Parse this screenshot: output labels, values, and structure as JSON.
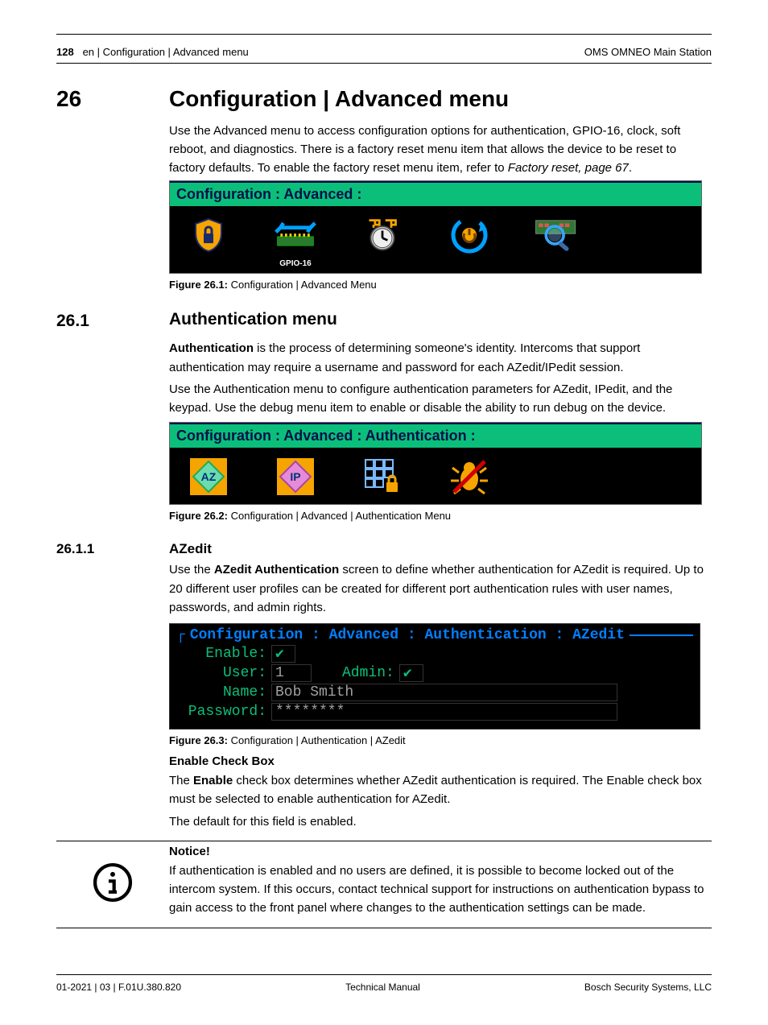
{
  "header": {
    "page_no": "128",
    "left": "en | Configuration | Advanced menu",
    "right": "OMS OMNEO Main Station"
  },
  "section26": {
    "num": "26",
    "title": "Configuration | Advanced menu",
    "p1": "Use the Advanced menu to access configuration options for authentication, GPIO-16, clock, soft reboot, and diagnostics. There is a factory reset menu item that allows the device to be reset to factory defaults. To enable the factory reset menu item, refer to ",
    "p1_link": "Factory reset, page 67",
    "p1_tail": "."
  },
  "fig261": {
    "breadcrumb": "Configuration : Advanced :",
    "caption_label": "Figure 26.1:",
    "caption": "Configuration | Advanced Menu",
    "icons": [
      "",
      "GPIO-16",
      "",
      "",
      ""
    ]
  },
  "section261": {
    "num": "26.1",
    "title": "Authentication menu",
    "p1a": "Authentication",
    "p1b": " is the process of determining someone's identity. Intercoms that support authentication may require a username and password for each AZedit/IPedit session.",
    "p2": "Use the Authentication menu to configure authentication parameters for AZedit, IPedit, and the keypad. Use the debug menu item to enable or disable the ability to run debug on the device."
  },
  "fig262": {
    "breadcrumb": "Configuration : Advanced : Authentication :",
    "caption_label": "Figure 26.2:",
    "caption": "Configuration | Advanced | Authentication Menu"
  },
  "section2611": {
    "num": "26.1.1",
    "title": "AZedit",
    "p1a": "Use the ",
    "p1b": "AZedit Authentication",
    "p1c": " screen to define whether authentication for AZedit is required. Up to 20 different user profiles can be created for different port authentication rules with user names, passwords, and admin rights."
  },
  "fig263": {
    "legend": "Configuration : Advanced : Authentication : AZedit",
    "rows": {
      "enable_label": "Enable:",
      "enable_value": "✔",
      "user_label": "User:",
      "user_value": "1",
      "admin_label": "Admin:",
      "admin_value": "✔",
      "name_label": "Name:",
      "name_value": "Bob Smith",
      "password_label": "Password:",
      "password_value": "********"
    },
    "caption_label": "Figure 26.3:",
    "caption": "Configuration | Authentication | AZedit"
  },
  "enable_box": {
    "heading": "Enable Check Box",
    "p1a": "The ",
    "p1b": "Enable",
    "p1c": " check box determines whether AZedit authentication is required. The Enable check box must be selected to enable authentication for AZedit.",
    "p2": "The default for this field is enabled."
  },
  "notice": {
    "heading": "Notice!",
    "body": "If authentication is enabled and no users are defined, it is possible to become locked out of the intercom system. If this occurs, contact technical support for instructions on authentication bypass to gain access to the front panel where changes to the authentication settings can be made."
  },
  "footer": {
    "left": "01-2021 | 03 | F.01U.380.820",
    "center": "Technical Manual",
    "right": "Bosch Security Systems, LLC"
  }
}
